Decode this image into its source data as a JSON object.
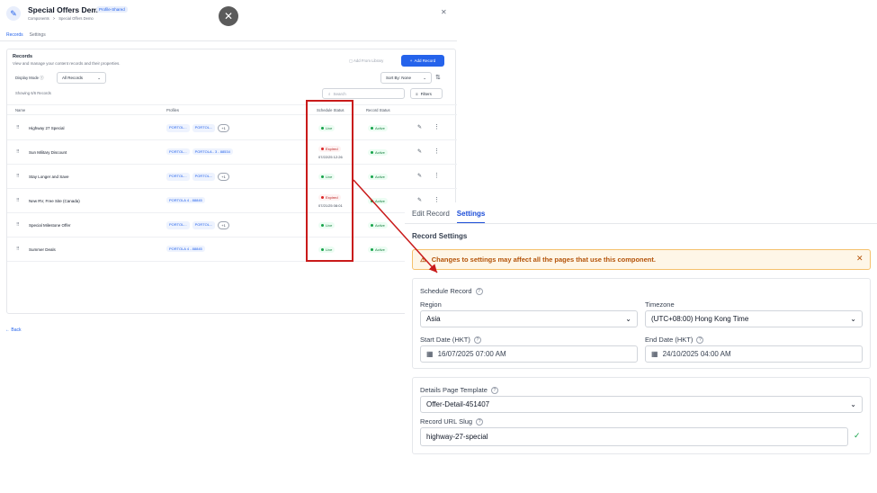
{
  "app": {
    "title": "Special Offers Demo",
    "badge": "Profile-Shared",
    "breadcrumb": [
      "Components",
      ">",
      "Special Offers Demo"
    ],
    "tabs": [
      "Records",
      "Settings"
    ]
  },
  "records_card": {
    "title": "Records",
    "description": "View and manage your content records and their properties.",
    "add_from_library": "Add From Library",
    "add_record": "Add Record",
    "display_mode_label": "Display Mode",
    "display_mode_value": "All Records",
    "sort_value": "Sort By: None",
    "showing": "Showing 6/6 Records",
    "search_placeholder": "Search",
    "filters": "Filters",
    "columns": [
      "Name",
      "Profiles",
      "Schedule Status",
      "Record Status"
    ],
    "rows": [
      {
        "name": "Highway 27 Special",
        "profiles": [
          "PORTOL...",
          "PORTOL...",
          "+1"
        ],
        "schedule": "Live",
        "expired_at": "",
        "status": "Active"
      },
      {
        "name": "Sun Military Discount",
        "profiles": [
          "PORTOL...",
          "PORTOLA - 3 - 88534"
        ],
        "schedule": "Expired",
        "expired_at": "07/22/25 12:26",
        "status": "Active"
      },
      {
        "name": "Stay Longer and Save",
        "profiles": [
          "PORTOL...",
          "PORTOL...",
          "+1"
        ],
        "schedule": "Live",
        "expired_at": "",
        "status": "Active"
      },
      {
        "name": "New RV, Free Site (Canada)",
        "profiles": [
          "PORTOLA 4 - 88845"
        ],
        "schedule": "Expired",
        "expired_at": "07/21/25 08:01",
        "status": "Active"
      },
      {
        "name": "Special Milestone Offer",
        "profiles": [
          "PORTOL...",
          "PORTOL...",
          "+1"
        ],
        "schedule": "Live",
        "expired_at": "",
        "status": "Active"
      },
      {
        "name": "Summer Deals",
        "profiles": [
          "PORTOLA 4 - 88845"
        ],
        "schedule": "Live",
        "expired_at": "",
        "status": "Active"
      }
    ],
    "back": "Back"
  },
  "settings_panel": {
    "tabs": [
      "Edit Record",
      "Settings"
    ],
    "title": "Record Settings",
    "warning": "Changes to settings may affect all the pages that use this component.",
    "schedule_label": "Schedule Record",
    "region_label": "Region",
    "region_value": "Asia",
    "timezone_label": "Timezone",
    "timezone_value": "(UTC+08:00) Hong Kong Time",
    "start_label": "Start Date (HKT)",
    "start_value": "16/07/2025 07:00 AM",
    "end_label": "End Date (HKT)",
    "end_value": "24/10/2025 04:00 AM",
    "template_label": "Details Page Template",
    "template_value": "Offer-Detail-451407",
    "slug_label": "Record URL Slug",
    "slug_value": "highway-27-special"
  },
  "colors": {
    "accent": "#2563eb",
    "highlight": "#c91a1a",
    "warning_bg": "#fef6e7"
  }
}
